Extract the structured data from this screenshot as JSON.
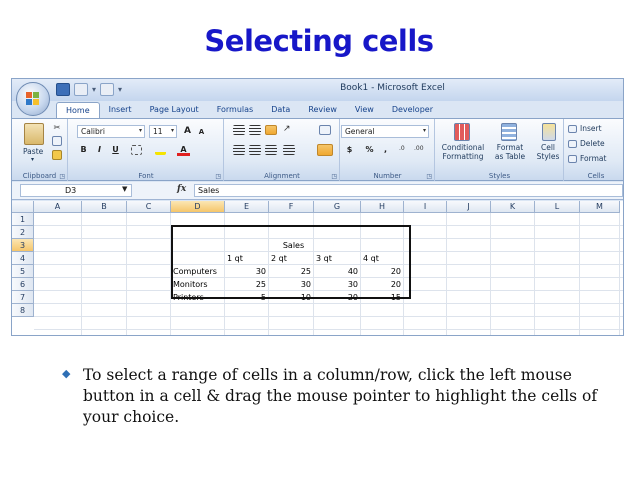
{
  "slide": {
    "title": "Selecting cells",
    "bullet": "To select a range of cells in a column/row, click the left mouse button in a cell & drag the mouse pointer to highlight the cells of your choice."
  },
  "excel": {
    "window_title": "Book1 - Microsoft Excel",
    "tabs": [
      "Home",
      "Insert",
      "Page Layout",
      "Formulas",
      "Data",
      "Review",
      "View",
      "Developer"
    ],
    "active_tab": "Home",
    "ribbon": {
      "clipboard": {
        "label": "Clipboard",
        "paste": "Paste"
      },
      "font": {
        "label": "Font",
        "family": "Calibri",
        "size": "11",
        "bold": "B",
        "italic": "I",
        "underline": "U"
      },
      "alignment": {
        "label": "Alignment"
      },
      "number": {
        "label": "Number",
        "format": "General",
        "currency": "$",
        "percent": "%",
        "comma": ","
      },
      "styles": {
        "label": "Styles",
        "conditional": "Conditional",
        "conditional2": "Formatting",
        "format_as": "Format",
        "format_as2": "as Table",
        "cell_styles": "Cell",
        "cell_styles2": "Styles"
      },
      "cells": {
        "label": "Cells",
        "insert": "Insert",
        "delete": "Delete",
        "format": "Format"
      }
    },
    "formula_bar": {
      "name_box": "D3",
      "fx": "fx",
      "content": "Sales"
    },
    "columns": [
      "A",
      "B",
      "C",
      "D",
      "E",
      "F",
      "G",
      "H",
      "I",
      "J",
      "K",
      "L",
      "M"
    ],
    "rows": [
      "1",
      "2",
      "3",
      "4",
      "5",
      "6",
      "7",
      "8"
    ],
    "table": {
      "title": "Sales",
      "headers": [
        "1 qt",
        "2 qt",
        "3 qt",
        "4 qt"
      ],
      "rows": [
        {
          "label": "Computers",
          "values": [
            "30",
            "25",
            "40",
            "20"
          ]
        },
        {
          "label": "Monitors",
          "values": [
            "25",
            "30",
            "30",
            "20"
          ]
        },
        {
          "label": "Printers",
          "values": [
            "5",
            "10",
            "20",
            "15"
          ]
        }
      ]
    },
    "colors": {
      "accent": "#1717c8",
      "ribbon": "#dfe9f5",
      "selected_header": "#f5c56a"
    }
  }
}
